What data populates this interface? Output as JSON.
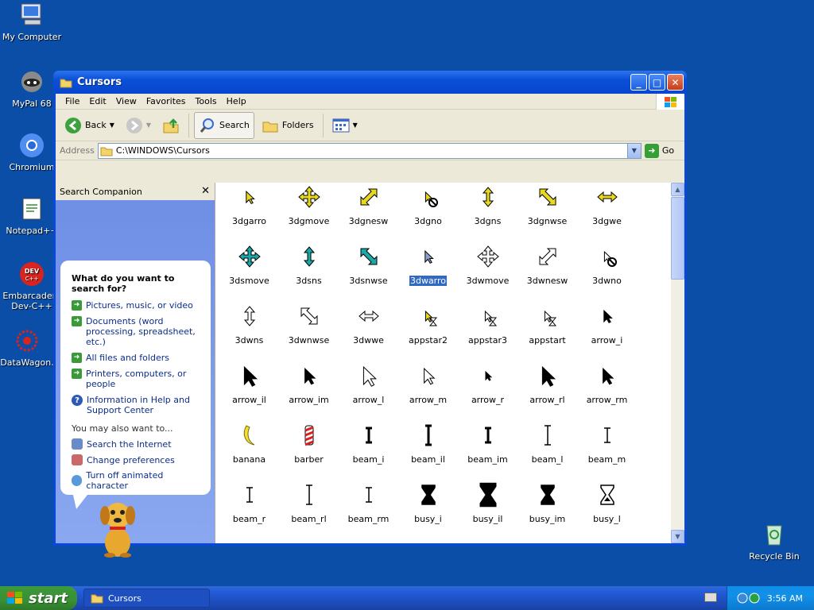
{
  "desktop": {
    "icons": [
      {
        "label": "My Computer"
      },
      {
        "label": "MyPal 68"
      },
      {
        "label": "Chromium"
      },
      {
        "label": "Notepad++"
      },
      {
        "label": "Embarcadero Dev-C++"
      },
      {
        "label": "DataWagon."
      },
      {
        "label": "Recycle Bin"
      }
    ]
  },
  "window": {
    "title": "Cursors",
    "menu": [
      "File",
      "Edit",
      "View",
      "Favorites",
      "Tools",
      "Help"
    ],
    "toolbar": {
      "back": "Back",
      "search": "Search",
      "folders": "Folders"
    },
    "address": {
      "label": "Address",
      "value": "C:\\WINDOWS\\Cursors",
      "go": "Go"
    }
  },
  "search_companion": {
    "header": "Search Companion",
    "question": "What do you want to search for?",
    "options": [
      "Pictures, music, or video",
      "Documents (word processing, spreadsheet, etc.)",
      "All files and folders",
      "Printers, computers, or people",
      "Information in Help and Support Center"
    ],
    "also_label": "You may also want to...",
    "also": [
      "Search the Internet",
      "Change preferences",
      "Turn off animated character"
    ]
  },
  "files": [
    {
      "name": "3dgarro",
      "icon": "arrow-yellow"
    },
    {
      "name": "3dgmove",
      "icon": "move-yellow"
    },
    {
      "name": "3dgnesw",
      "icon": "diag-nesw-yellow"
    },
    {
      "name": "3dgno",
      "icon": "no-yellow"
    },
    {
      "name": "3dgns",
      "icon": "ns-yellow"
    },
    {
      "name": "3dgnwse",
      "icon": "diag-nwse-yellow"
    },
    {
      "name": "3dgwe",
      "icon": "we-yellow"
    },
    {
      "name": "3dsmove",
      "icon": "move-teal"
    },
    {
      "name": "3dsns",
      "icon": "ns-teal"
    },
    {
      "name": "3dsnwse",
      "icon": "diag-nwse-teal"
    },
    {
      "name": "3dwarro",
      "icon": "arrow-gray",
      "selected": true
    },
    {
      "name": "3dwmove",
      "icon": "move-white"
    },
    {
      "name": "3dwnesw",
      "icon": "diag-nesw-white"
    },
    {
      "name": "3dwno",
      "icon": "no-white"
    },
    {
      "name": "3dwns",
      "icon": "ns-white"
    },
    {
      "name": "3dwnwse",
      "icon": "diag-nwse-white"
    },
    {
      "name": "3dwwe",
      "icon": "we-white"
    },
    {
      "name": "appstar2",
      "icon": "appstar-yellow"
    },
    {
      "name": "appstar3",
      "icon": "appstar-white"
    },
    {
      "name": "appstart",
      "icon": "appstar-white"
    },
    {
      "name": "arrow_i",
      "icon": "arrow-black-small"
    },
    {
      "name": "arrow_il",
      "icon": "arrow-black-large"
    },
    {
      "name": "arrow_im",
      "icon": "arrow-black-med"
    },
    {
      "name": "arrow_l",
      "icon": "arrow-white-large"
    },
    {
      "name": "arrow_m",
      "icon": "arrow-white-med"
    },
    {
      "name": "arrow_r",
      "icon": "arrow-black-tiny"
    },
    {
      "name": "arrow_rl",
      "icon": "arrow-black-large"
    },
    {
      "name": "arrow_rm",
      "icon": "arrow-black-med"
    },
    {
      "name": "banana",
      "icon": "banana"
    },
    {
      "name": "barber",
      "icon": "barber"
    },
    {
      "name": "beam_i",
      "icon": "beam-bold"
    },
    {
      "name": "beam_il",
      "icon": "beam-bold-large"
    },
    {
      "name": "beam_im",
      "icon": "beam-bold"
    },
    {
      "name": "beam_l",
      "icon": "beam-thin-large"
    },
    {
      "name": "beam_m",
      "icon": "beam-thin"
    },
    {
      "name": "beam_r",
      "icon": "beam-thin"
    },
    {
      "name": "beam_rl",
      "icon": "beam-thin-large"
    },
    {
      "name": "beam_rm",
      "icon": "beam-thin"
    },
    {
      "name": "busy_i",
      "icon": "hourglass-black"
    },
    {
      "name": "busy_il",
      "icon": "hourglass-black-large"
    },
    {
      "name": "busy_im",
      "icon": "hourglass-black"
    },
    {
      "name": "busy_l",
      "icon": "hourglass-white"
    },
    {
      "name": "",
      "icon": "hourglass-white"
    },
    {
      "name": "",
      "icon": "hourglass-black-small"
    },
    {
      "name": "",
      "icon": "hourglass-white"
    },
    {
      "name": "",
      "icon": "hourglass-white-small"
    },
    {
      "name": "",
      "icon": "circle-yellow"
    },
    {
      "name": "",
      "icon": "arrow-glasses"
    },
    {
      "name": "",
      "icon": "cross"
    }
  ],
  "taskbar": {
    "start": "start",
    "task": "Cursors",
    "time": "3:56 AM"
  }
}
